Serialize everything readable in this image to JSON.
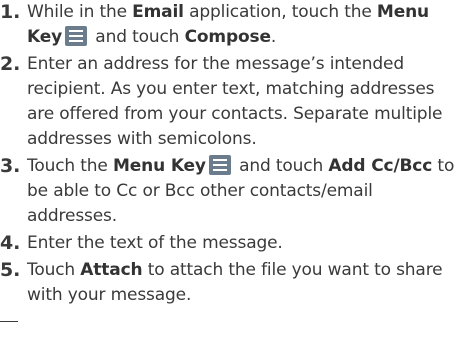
{
  "steps": [
    {
      "num": "1.",
      "p1": "While in the ",
      "b1": "Email",
      "p2": " application, touch the ",
      "b2": "Menu Key",
      "p3": " and touch ",
      "b3": "Compose",
      "p4": "."
    },
    {
      "num": "2.",
      "text": "Enter an address for the message’s intended recipient. As you enter text, matching addresses are offered from your contacts. Separate multiple addresses with semicolons."
    },
    {
      "num": "3.",
      "p1": "Touch the ",
      "b1": "Menu Key",
      "p2": " and touch ",
      "b2": "Add Cc/Bcc",
      "p3": " to be able to Cc or Bcc other contacts/email addresses."
    },
    {
      "num": "4.",
      "text": "Enter the text of the message."
    },
    {
      "num": "5.",
      "p1": "Touch ",
      "b1": "Attach",
      "p2": " to attach the file you want to share with your message."
    }
  ],
  "icons": {
    "menu_key": "menu-key-icon"
  }
}
